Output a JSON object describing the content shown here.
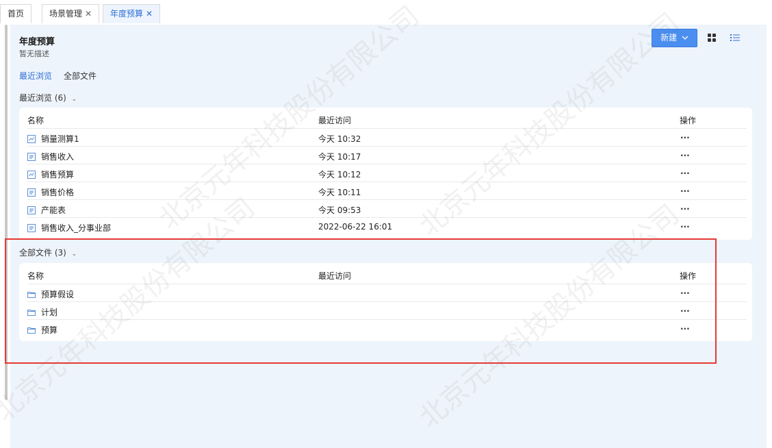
{
  "tabs": [
    {
      "label": "首页",
      "closable": false,
      "active": false
    },
    {
      "label": "场景管理",
      "closable": true,
      "active": false
    },
    {
      "label": "年度预算",
      "closable": true,
      "active": true
    }
  ],
  "tab_close_glyph": "✕",
  "page": {
    "title": "年度预算",
    "description": "暂无描述"
  },
  "toolbar": {
    "new_label": "新建",
    "new_icon": "chevron-down-icon",
    "accent": "#4a8ef0"
  },
  "subtabs": {
    "recent": "最近浏览",
    "all": "全部文件",
    "active_color": "#2f6fd6"
  },
  "recent": {
    "header": "最近浏览",
    "count": "(6)",
    "columns": {
      "name": "名称",
      "time": "最近访问",
      "op": "操作"
    },
    "rows": [
      {
        "icon": "chart-icon",
        "name": "销量测算1",
        "time": "今天 10:32",
        "op": "···"
      },
      {
        "icon": "form-icon",
        "name": "销售收入",
        "time": "今天 10:17",
        "op": "···"
      },
      {
        "icon": "chart-icon",
        "name": "销售预算",
        "time": "今天 10:12",
        "op": "···"
      },
      {
        "icon": "form-icon",
        "name": "销售价格",
        "time": "今天 10:11",
        "op": "···"
      },
      {
        "icon": "form-icon",
        "name": "产能表",
        "time": "今天 09:53",
        "op": "···"
      },
      {
        "icon": "form-icon",
        "name": "销售收入_分事业部",
        "time": "2022-06-22 16:01",
        "op": "···"
      }
    ]
  },
  "all": {
    "header": "全部文件",
    "count": "(3)",
    "columns": {
      "name": "名称",
      "time": "最近访问",
      "op": "操作"
    },
    "rows": [
      {
        "icon": "folder-icon",
        "name": "预算假设",
        "op": "···"
      },
      {
        "icon": "folder-icon",
        "name": "计划",
        "op": "···"
      },
      {
        "icon": "folder-icon",
        "name": "预算",
        "op": "···"
      }
    ]
  },
  "watermark_text": "北京元年科技股份有限公司",
  "highlight_color": "#e53935"
}
